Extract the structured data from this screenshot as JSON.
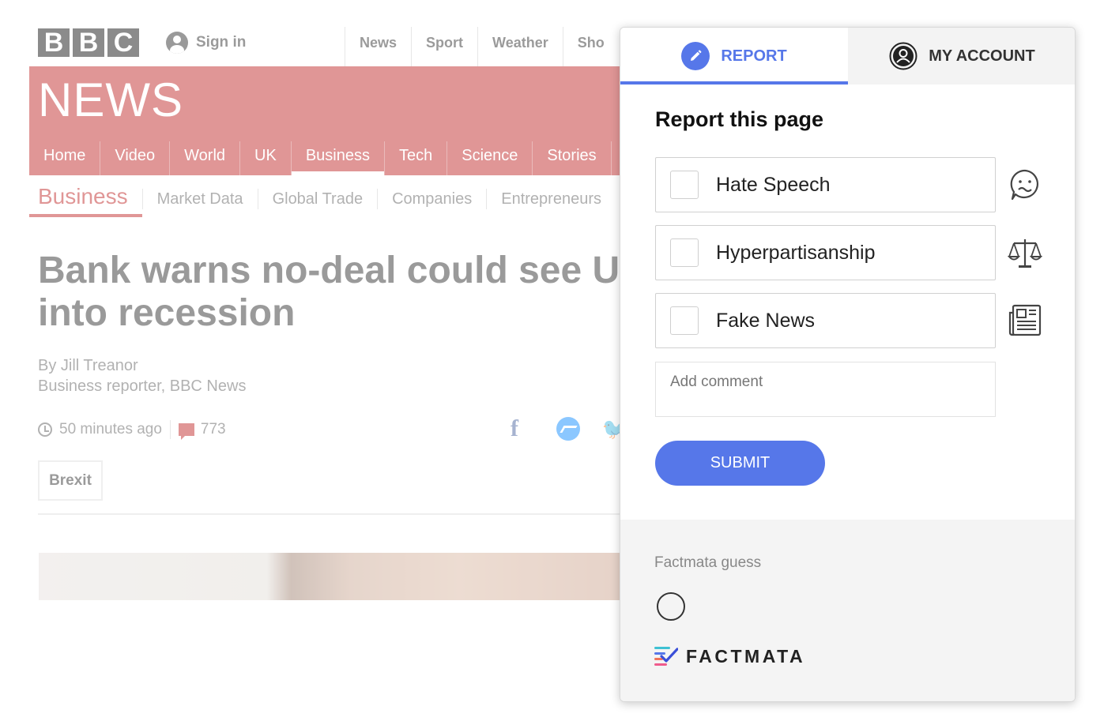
{
  "background_page": {
    "logo_letters": [
      "B",
      "B",
      "C"
    ],
    "sign_in": "Sign in",
    "top_nav": [
      "News",
      "Sport",
      "Weather",
      "Sho"
    ],
    "section_wordmark": "NEWS",
    "news_nav": [
      "Home",
      "Video",
      "World",
      "UK",
      "Business",
      "Tech",
      "Science",
      "Stories"
    ],
    "news_nav_active": "Business",
    "subnav_section": "Business",
    "subnav_items": [
      "Market Data",
      "Global Trade",
      "Companies",
      "Entrepreneurs"
    ],
    "headline": "Bank warns no-deal could see U into recession",
    "author": "By Jill Treanor",
    "author_role": "Business reporter, BBC News",
    "timestamp": "50 minutes ago",
    "comment_count": "773",
    "tag": "Brexit",
    "share_icons": [
      "facebook-icon",
      "messenger-icon",
      "twitter-icon"
    ],
    "brand_color": "#bb1919"
  },
  "popup": {
    "tabs": {
      "report": "REPORT",
      "account": "MY ACCOUNT",
      "active": "report"
    },
    "title": "Report this page",
    "options": [
      {
        "label": "Hate Speech",
        "icon": "worried-face-icon",
        "checked": false
      },
      {
        "label": "Hyperpartisanship",
        "icon": "scales-icon",
        "checked": false
      },
      {
        "label": "Fake News",
        "icon": "newspaper-icon",
        "checked": false
      }
    ],
    "comment_placeholder": "Add comment",
    "submit_label": "SUBMIT",
    "guess_label": "Factmata guess",
    "brand_name": "FACTMATA",
    "accent_color": "#5677e9"
  }
}
